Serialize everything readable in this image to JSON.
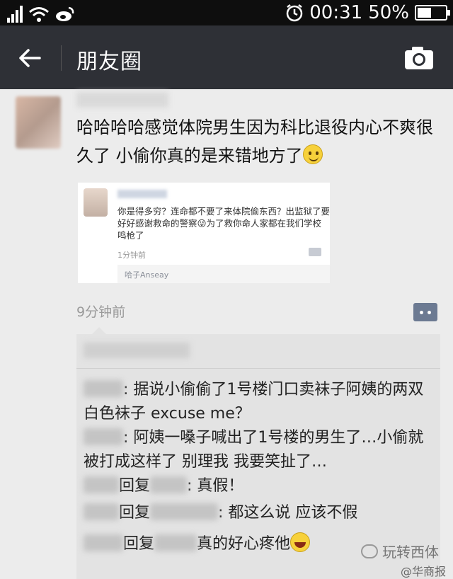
{
  "status_bar": {
    "time": "00:31",
    "battery_percent": "50%",
    "battery_level": 0.5,
    "icons": [
      "signal-icon",
      "wifi-icon",
      "weibo-icon",
      "alarm-icon",
      "battery-icon"
    ]
  },
  "nav": {
    "title": "朋友圈",
    "back_icon": "back-arrow-icon",
    "camera_icon": "camera-icon"
  },
  "post": {
    "text": "哈哈哈哈感觉体院男生因为科比退役内心不爽很久了 小偷你真的是来错地方了",
    "time": "9分钟前",
    "embedded": {
      "text": "你是得多穷？连命都不要了来体院偷东西？出监狱了要好好感谢救命的警察😜为了救你命人家都在我们学校鸣枪了",
      "time": "1分钟前",
      "comment_preview": "哈子Anseay"
    }
  },
  "comments": [
    {
      "name_sep": ": ",
      "text": "据说小偷偷了1号楼门口卖袜子阿姨的两双白色袜子 excuse me？"
    },
    {
      "name_sep": ": ",
      "text": "阿姨一嗓子喊出了1号楼的男生了…小偷就被打成这样了 别理我 我要笑扯了…"
    },
    {
      "reply_word": "回复",
      "name_sep": ": ",
      "text": "真假！"
    },
    {
      "reply_word": "回复",
      "name_sep": ": ",
      "text": "都这么说 应该不假"
    },
    {
      "reply_word": "回复",
      "name_sep": ": ",
      "text": "真的好心疼他"
    }
  ],
  "watermark": {
    "text": "玩转西体",
    "source": "@华商报"
  },
  "colors": {
    "status_bar": "#0e0e0e",
    "nav_bar": "#2e3036",
    "background": "#ececec",
    "comment_box": "#e3e3e3",
    "more_button": "#6c7a92"
  }
}
